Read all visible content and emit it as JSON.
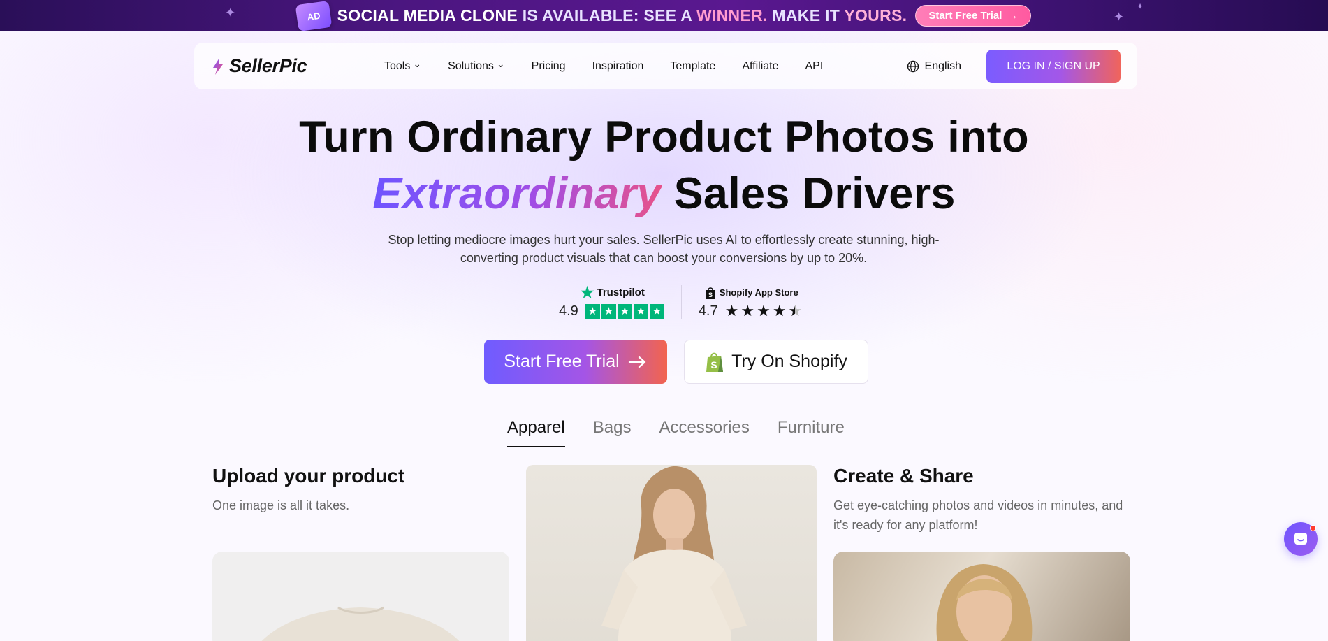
{
  "promo": {
    "badge_text": "AD",
    "highlight_1": "SOCIAL MEDIA CLONE",
    "text_1": " IS AVAILABLE: SEE A ",
    "highlight_2": "WINNER.",
    "text_2": " MAKE IT ",
    "highlight_3": "YOURS.",
    "cta_label": "Start Free Trial",
    "arrow": "→"
  },
  "nav": {
    "logo": "SellerPic",
    "items": [
      {
        "label": "Tools",
        "caret": "⌄"
      },
      {
        "label": "Solutions",
        "caret": "⌄"
      },
      {
        "label": "Pricing"
      },
      {
        "label": "Inspiration"
      },
      {
        "label": "Template"
      },
      {
        "label": "Affiliate"
      },
      {
        "label": "API"
      }
    ],
    "language": "English",
    "login_label": "LOG IN / SIGN UP"
  },
  "hero": {
    "title_line1": "Turn Ordinary Product Photos into",
    "title_accent": "Extraordinary",
    "title_line2_rest": " Sales Drivers",
    "subtitle": "Stop letting mediocre images hurt your sales. SellerPic uses AI to effortlessly create stunning, high-converting product visuals that can boost your conversions by up to 20%."
  },
  "ratings": {
    "trustpilot": {
      "label": "Trustpilot",
      "score": "4.9",
      "stars": 5
    },
    "shopify": {
      "label": "Shopify App Store",
      "score": "4.7",
      "stars": 4.5
    }
  },
  "cta": {
    "primary_label": "Start Free Trial",
    "secondary_label": "Try On Shopify"
  },
  "tabs": [
    {
      "label": "Apparel",
      "active": true
    },
    {
      "label": "Bags",
      "active": false
    },
    {
      "label": "Accessories",
      "active": false
    },
    {
      "label": "Furniture",
      "active": false
    }
  ],
  "steps": {
    "upload": {
      "title": "Upload your product",
      "desc": "One image is all it takes."
    },
    "create": {
      "title": "Create & Share",
      "desc": "Get eye-catching photos and videos in minutes, and it's ready for any platform!"
    }
  },
  "colors": {
    "accent_purple": "#6f55ff",
    "accent_pink": "#e7528a",
    "trustpilot_green": "#00b67a"
  }
}
